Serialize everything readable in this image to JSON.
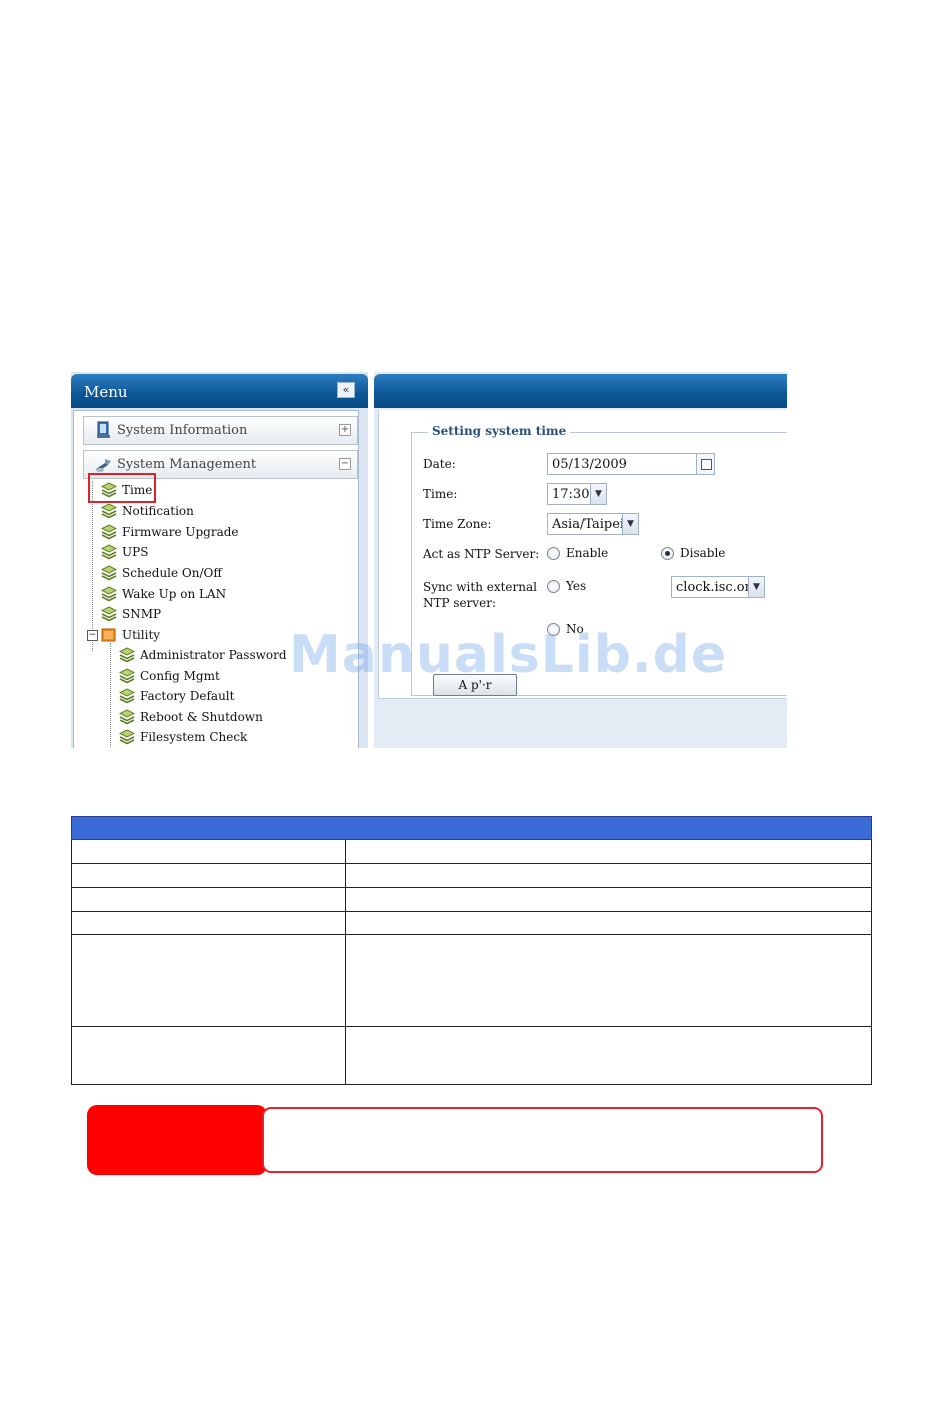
{
  "menu": {
    "title": "Menu",
    "collapse_symbol": "«",
    "sections": [
      {
        "label": "System Information",
        "toggle": "+"
      },
      {
        "label": "System Management",
        "toggle": "−"
      }
    ],
    "system_management_items": [
      {
        "label": "Time",
        "selected": true
      },
      {
        "label": "Notification"
      },
      {
        "label": "Firmware Upgrade"
      },
      {
        "label": "UPS"
      },
      {
        "label": "Schedule On/Off"
      },
      {
        "label": "Wake Up on LAN"
      },
      {
        "label": "SNMP"
      }
    ],
    "utility": {
      "label": "Utility",
      "toggle": "−",
      "items": [
        {
          "label": "Administrator Password"
        },
        {
          "label": "Config Mgmt"
        },
        {
          "label": "Factory Default"
        },
        {
          "label": "Reboot & Shutdown"
        },
        {
          "label": "Filesystem Check"
        }
      ]
    }
  },
  "form": {
    "legend": "Setting system time",
    "date_label": "Date:",
    "date_value": "05/13/2009",
    "time_label": "Time:",
    "time_value": "17:30",
    "timezone_label": "Time Zone:",
    "timezone_value": "Asia/Taipei",
    "ntp_server_label": "Act as NTP Server:",
    "ntp_enable_label": "Enable",
    "ntp_disable_label": "Disable",
    "ntp_selected": "Disable",
    "sync_label_line1": "Sync with external",
    "sync_label_line2": "NTP server:",
    "sync_yes_label": "Yes",
    "sync_no_label": "No",
    "ntp_host_value": "clock.isc.org",
    "apply_label": "A  p'·r",
    "dropdown_symbol": "▼"
  },
  "watermark": "ManualsLib.de",
  "colors": {
    "header_blue": "#0c5595",
    "table_header": "#3b6bd6",
    "note_red": "#ff0000",
    "highlight_red": "#d9242a"
  }
}
